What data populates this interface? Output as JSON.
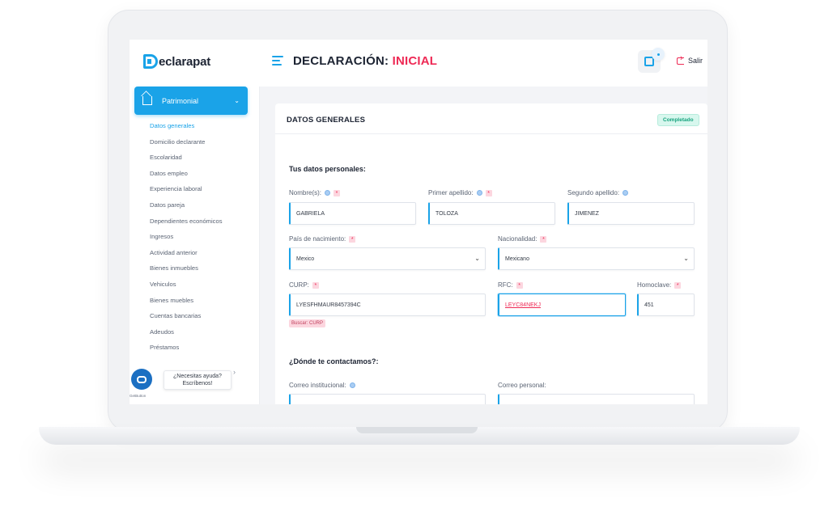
{
  "app": {
    "logo_text": "Declarapat"
  },
  "header": {
    "title_prefix": "DECLARACIÓN:",
    "title_accent": "INICIAL",
    "logout_label": "Salir"
  },
  "sidebar": {
    "section_label": "Patrimonial",
    "items": [
      "Datos generales",
      "Domicilio declarante",
      "Escolaridad",
      "Datos empleo",
      "Experiencia laboral",
      "Datos pareja",
      "Dependientes económicos",
      "Ingresos",
      "Actividad anterior",
      "Bienes inmuebles",
      "Vehiculos",
      "Bienes muebles",
      "Cuentas bancarias",
      "Adeudos",
      "Préstamos"
    ],
    "active_index": 0
  },
  "help": {
    "tooltip_line1": "¿Necesitas ayuda?",
    "tooltip_line2": "Escríbenos!",
    "brand": "GetButton"
  },
  "card": {
    "title": "DATOS GENERALES",
    "status": "Completado",
    "personal_section": "Tus datos personales:",
    "contact_section": "¿Dónde te contactamos?:",
    "fields": {
      "nombre": {
        "label": "Nombre(s):",
        "value": "GABRIELA"
      },
      "primer_apellido": {
        "label": "Primer apellido:",
        "value": "TOLOZA"
      },
      "segundo_apellido": {
        "label": "Segundo apellido:",
        "value": "JIMENEZ"
      },
      "pais": {
        "label": "País de nacimiento:",
        "value": "Mexico"
      },
      "nacionalidad": {
        "label": "Nacionalidad:",
        "value": "Mexicano"
      },
      "curp": {
        "label": "CURP:",
        "value": "LYESFHMAUR8457394C",
        "search_label": "Buscar: CURP"
      },
      "rfc": {
        "label": "RFC:",
        "value": "LEYC84NEKJ"
      },
      "homoclave": {
        "label": "Homoclave:",
        "value": "451"
      },
      "correo_institucional": {
        "label": "Correo institucional:"
      },
      "correo_personal": {
        "label": "Correo personal:"
      }
    },
    "required_mark": "*"
  },
  "colors": {
    "accent": "#1aa3e8",
    "brand_red": "#ee2a55",
    "status_green": "#16a37e"
  }
}
